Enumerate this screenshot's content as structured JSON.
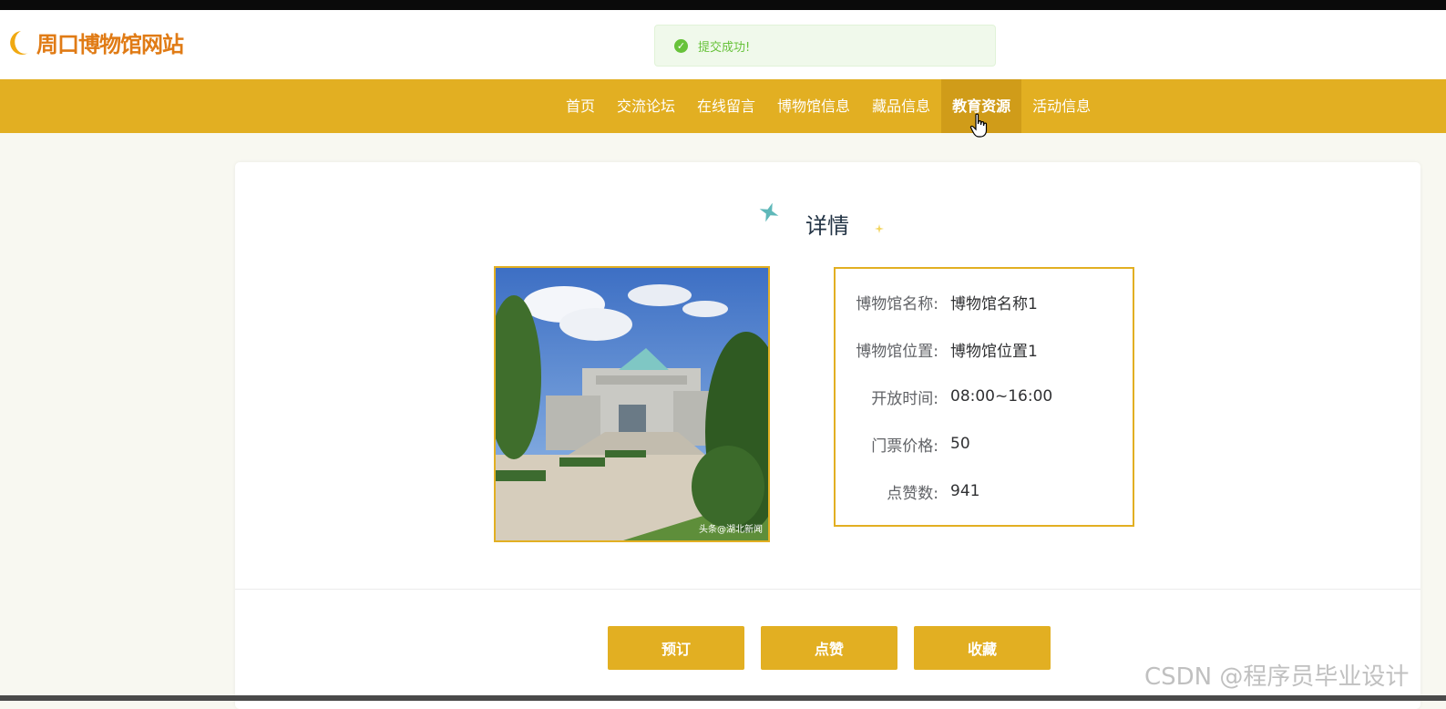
{
  "site": {
    "title": "周口博物馆网站",
    "brand_color": "#e07b15"
  },
  "toast": {
    "message": "提交成功!",
    "icon": "check-circle-icon",
    "color": "#67c23a"
  },
  "nav": {
    "color": "#e2af22",
    "items": [
      {
        "label": "首页"
      },
      {
        "label": "交流论坛"
      },
      {
        "label": "在线留言"
      },
      {
        "label": "博物馆信息"
      },
      {
        "label": "藏品信息"
      },
      {
        "label": "教育资源",
        "active": true
      },
      {
        "label": "活动信息"
      }
    ]
  },
  "detail": {
    "title": "详情",
    "image_caption": "头条@湖北新闻",
    "fields": [
      {
        "label": "博物馆名称:",
        "value": "博物馆名称1"
      },
      {
        "label": "博物馆位置:",
        "value": "博物馆位置1"
      },
      {
        "label": "开放时间:",
        "value": "08:00~16:00"
      },
      {
        "label": "门票价格:",
        "value": "50"
      },
      {
        "label": "点赞数:",
        "value": "941"
      }
    ]
  },
  "actions": {
    "book": "预订",
    "like": "点赞",
    "favorite": "收藏"
  },
  "watermark": "CSDN @程序员毕业设计"
}
